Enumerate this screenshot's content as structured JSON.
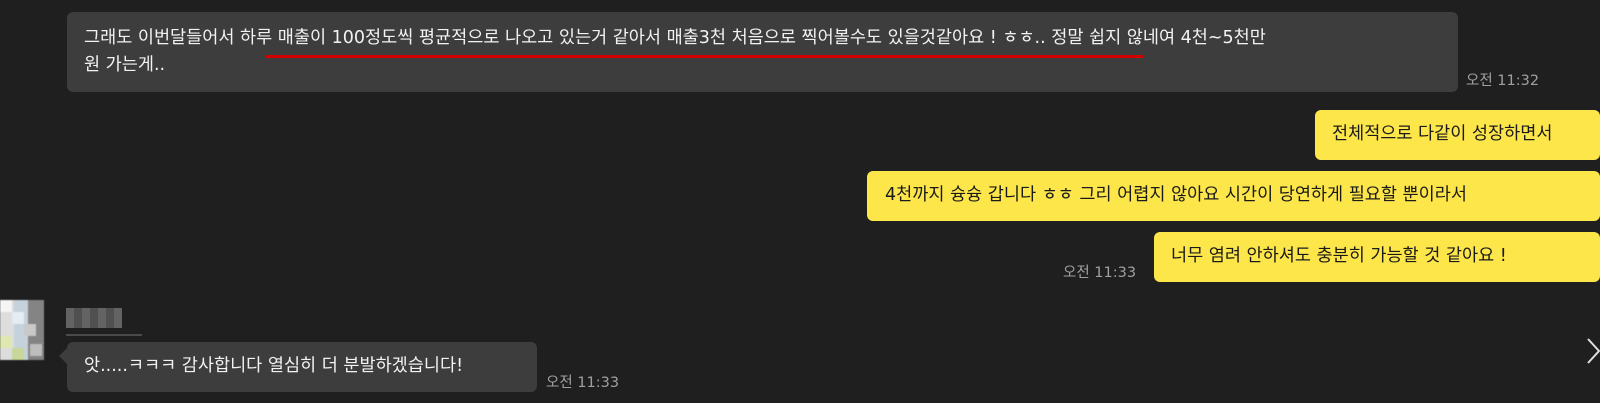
{
  "messages": [
    {
      "line1_before": "그래도 이번달들어서 ",
      "line1_highlight": "하루 매출이 100정도씩 평균적으로 나오고 있는거 같아서 매출3천 처음으로 찍어볼수도 있을것같아요 !",
      "line1_after": " ㅎㅎ.. 정말 쉽지 않네여 4천~5천만",
      "line2": "원 가는게..",
      "time": "오전 11:32"
    },
    {
      "text": "전체적으로 다같이 성장하면서"
    },
    {
      "text": "4천까지 슝슝 갑니다 ㅎㅎ 그리 어렵지 않아요 시간이 당연하게 필요할 뿐이라서"
    },
    {
      "text": "너무 염려 안하셔도 충분히 가능할 것 같아요 !",
      "time": "오전 11:33"
    },
    {
      "text": "앗.....ㅋㅋㅋ 감사합니다 열심히 더 분발하겠습니다!",
      "time": "오전 11:33"
    }
  ],
  "icons": {
    "next": "chevron-right-icon"
  },
  "colors": {
    "background": "#1f1f1f",
    "incoming_bubble": "#3d3d3d",
    "outgoing_bubble": "#fde64a",
    "highlight_underline": "#d40000",
    "timestamp": "#a0a0a0"
  }
}
